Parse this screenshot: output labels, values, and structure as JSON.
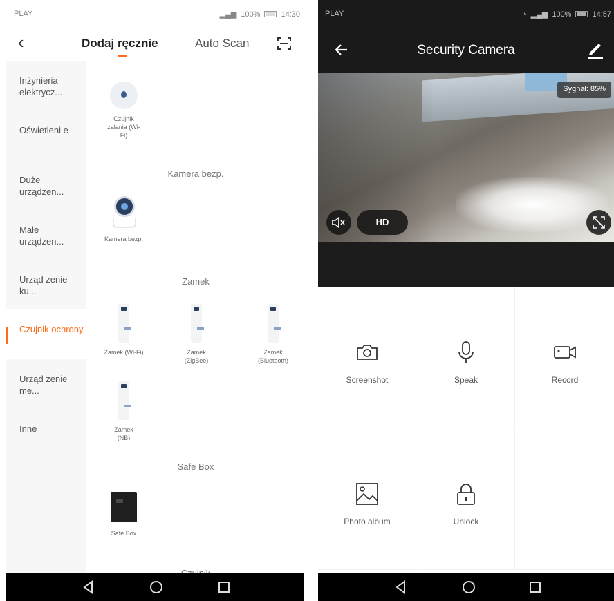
{
  "left": {
    "status_bar": {
      "carrier": "PLAY",
      "battery": "100%",
      "time": "14:30"
    },
    "header": {
      "back_label": "‹",
      "tab_manual": "Dodaj ręcznie",
      "tab_auto": "Auto Scan",
      "scan_icon": "scan-icon"
    },
    "categories": [
      {
        "label": "Inżynieria elektrycz...",
        "active": false
      },
      {
        "label": "Oświetleni e",
        "active": false
      },
      {
        "label": "Duże urządzen...",
        "active": false
      },
      {
        "label": "Małe urządzen...",
        "active": false
      },
      {
        "label": "Urząd zenie ku...",
        "active": false
      },
      {
        "label": "Czujnik ochrony",
        "active": true
      },
      {
        "label": "Urząd zenie me...",
        "active": false
      },
      {
        "label": "Inne",
        "active": false
      }
    ],
    "devices": {
      "flood_sensor": "Czujnik zalania (Wi-Fi)",
      "section_camera": "Kamera bezp.",
      "camera": "Kamera bezp.",
      "section_lock": "Zamek",
      "lock_wifi": "Zamek (Wi-Fi)",
      "lock_zigbee": "Zamek (ZigBee)",
      "lock_bt": "Zamek (Bluetooth)",
      "lock_nb": "Zamek (NB)",
      "section_safe": "Safe Box",
      "safe": "Safe Box",
      "section_next": "Czujnik"
    }
  },
  "right": {
    "status_bar": {
      "carrier": "PLAY",
      "battery": "100%",
      "time": "14:57"
    },
    "header": {
      "title": "Security Camera"
    },
    "video": {
      "signal": "Sygnał: 85%",
      "quality": "HD"
    },
    "actions": [
      {
        "label": "Screenshot",
        "icon": "camera-icon"
      },
      {
        "label": "Speak",
        "icon": "microphone-icon"
      },
      {
        "label": "Record",
        "icon": "video-record-icon"
      },
      {
        "label": "Photo album",
        "icon": "image-icon"
      },
      {
        "label": "Unlock",
        "icon": "padlock-icon"
      }
    ]
  },
  "colors": {
    "accent": "#ff6a1a",
    "dark_bar": "#1a1a1a"
  }
}
